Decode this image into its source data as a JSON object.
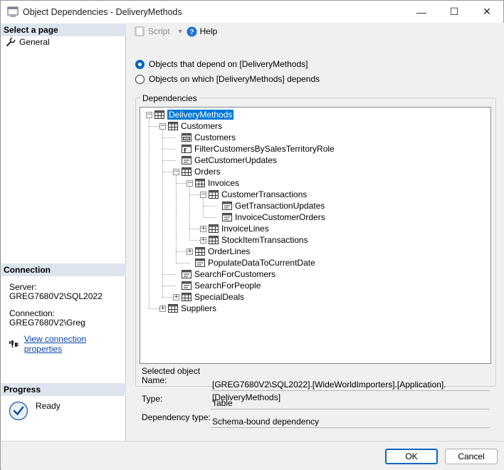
{
  "window": {
    "title": "Object Dependencies - DeliveryMethods",
    "minimize": "—",
    "maximize": "☐",
    "close": "✕"
  },
  "left": {
    "select_page_header": "Select a page",
    "pages": [
      "General"
    ],
    "connection_header": "Connection",
    "server_label": "Server:",
    "server_value": "GREG7680V2\\SQL2022",
    "connection_label": "Connection:",
    "connection_value": "GREG7680V2\\Greg",
    "view_connection_link": "View connection properties",
    "progress_header": "Progress",
    "progress_status": "Ready"
  },
  "toolbar": {
    "script_label": "Script",
    "help_label": "Help"
  },
  "options": {
    "depend_on": "Objects that depend on [DeliveryMethods]",
    "depends": "Objects on which [DeliveryMethods] depends",
    "selected": "depend_on"
  },
  "dependencies": {
    "group_label": "Dependencies",
    "tree": [
      {
        "label": "DeliveryMethods",
        "level": 0,
        "icon": "table-icon",
        "expander": "minus",
        "selected": true
      },
      {
        "label": "Customers",
        "level": 1,
        "icon": "table-icon",
        "expander": "minus"
      },
      {
        "label": "Customers",
        "level": 2,
        "icon": "view-icon",
        "expander": "none"
      },
      {
        "label": "FilterCustomersBySalesTerritoryRole",
        "level": 2,
        "icon": "function-icon",
        "expander": "none"
      },
      {
        "label": "GetCustomerUpdates",
        "level": 2,
        "icon": "procedure-icon",
        "expander": "none"
      },
      {
        "label": "Orders",
        "level": 2,
        "icon": "table-icon",
        "expander": "minus"
      },
      {
        "label": "Invoices",
        "level": 3,
        "icon": "table-icon",
        "expander": "minus"
      },
      {
        "label": "CustomerTransactions",
        "level": 4,
        "icon": "table-icon",
        "expander": "minus"
      },
      {
        "label": "GetTransactionUpdates",
        "level": 5,
        "icon": "procedure-icon",
        "expander": "none"
      },
      {
        "label": "InvoiceCustomerOrders",
        "level": 5,
        "icon": "procedure-icon",
        "expander": "none"
      },
      {
        "label": "InvoiceLines",
        "level": 4,
        "icon": "table-icon",
        "expander": "plus"
      },
      {
        "label": "StockItemTransactions",
        "level": 4,
        "icon": "table-icon",
        "expander": "plus"
      },
      {
        "label": "OrderLines",
        "level": 3,
        "icon": "table-icon",
        "expander": "plus"
      },
      {
        "label": "PopulateDataToCurrentDate",
        "level": 3,
        "icon": "procedure-icon",
        "expander": "none"
      },
      {
        "label": "SearchForCustomers",
        "level": 2,
        "icon": "procedure-icon",
        "expander": "none"
      },
      {
        "label": "SearchForPeople",
        "level": 2,
        "icon": "procedure-icon",
        "expander": "none"
      },
      {
        "label": "SpecialDeals",
        "level": 2,
        "icon": "table-icon",
        "expander": "plus"
      },
      {
        "label": "Suppliers",
        "level": 1,
        "icon": "table-icon",
        "expander": "plus"
      }
    ]
  },
  "details": {
    "selected_object_label": "Selected object",
    "name_label": "Name:",
    "name_value": "[GREG7680V2\\SQL2022].[WideWorldImporters].[Application].[DeliveryMethods]",
    "type_label": "Type:",
    "type_value": "Table",
    "dependency_type_label": "Dependency type:",
    "dependency_type_value": "Schema-bound dependency"
  },
  "buttons": {
    "ok": "OK",
    "cancel": "Cancel"
  },
  "colors": {
    "accent": "#0078d7",
    "section_header_bg": "#dde4ee",
    "link": "#0645ad"
  }
}
